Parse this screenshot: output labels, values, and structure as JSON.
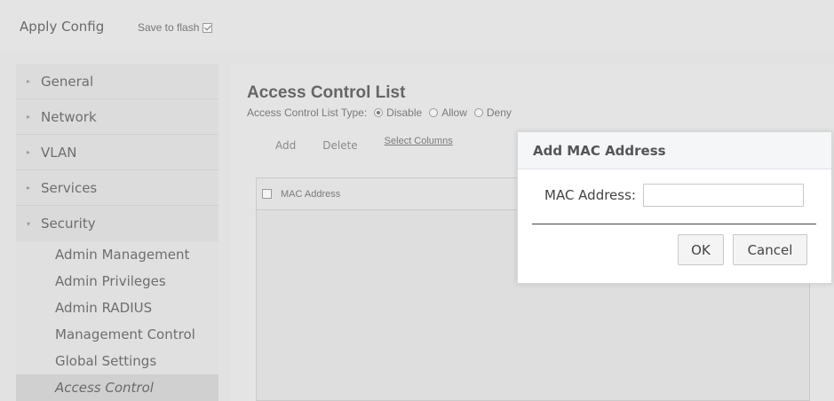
{
  "topbar": {
    "apply_label": "Apply Config",
    "save_flash_label": "Save to flash",
    "save_flash_checked": true
  },
  "sidebar": {
    "items": [
      {
        "label": "General"
      },
      {
        "label": "Network"
      },
      {
        "label": "VLAN"
      },
      {
        "label": "Services"
      },
      {
        "label": "Security"
      }
    ],
    "security_items": [
      {
        "label": "Admin Management"
      },
      {
        "label": "Admin Privileges"
      },
      {
        "label": "Admin RADIUS"
      },
      {
        "label": "Management Control"
      },
      {
        "label": "Global Settings"
      },
      {
        "label": "Access Control"
      }
    ]
  },
  "main": {
    "title": "Access Control List",
    "acl_type_label": "Access Control List Type:",
    "acl_options": [
      "Disable",
      "Allow",
      "Deny"
    ],
    "acl_selected": "Disable",
    "toolbar": {
      "add": "Add",
      "delete": "Delete",
      "select_columns": "Select Columns"
    },
    "grid": {
      "columns": [
        "MAC Address"
      ]
    }
  },
  "dialog": {
    "title": "Add MAC Address",
    "field_label": "MAC Address:",
    "field_value": "",
    "ok_label": "OK",
    "cancel_label": "Cancel"
  }
}
